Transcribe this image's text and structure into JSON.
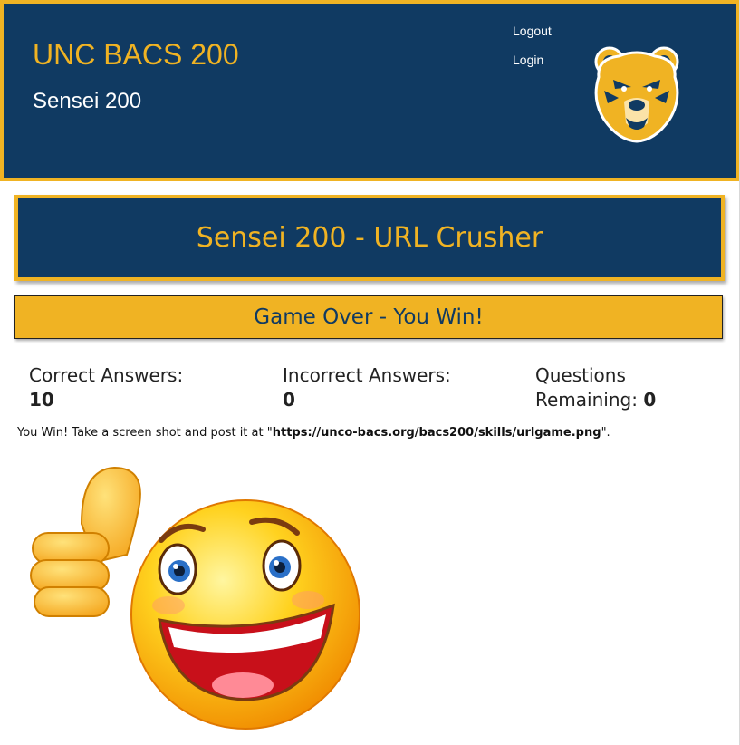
{
  "header": {
    "brand": "UNC BACS 200",
    "subtitle": "Sensei 200",
    "nav": {
      "logout": "Logout",
      "login": "Login"
    },
    "logo_icon": "bear-mascot-icon"
  },
  "game": {
    "title": "Sensei 200 - URL Crusher",
    "status": "Game Over - You Win!"
  },
  "stats": {
    "correct": {
      "label": "Correct Answers:",
      "value": "10"
    },
    "incorrect": {
      "label": "Incorrect Answers:",
      "value": "0"
    },
    "remaining": {
      "label_line1": "Questions",
      "label_line2": "Remaining:",
      "value": "0"
    }
  },
  "message": {
    "prefix": "You Win! Take a screen shot and post it at \"",
    "url": "https://unco-bacs.org/bacs200/skills/urlgame.png",
    "suffix": "\"."
  },
  "image": {
    "icon": "thumbs-up-smiley-icon"
  },
  "colors": {
    "navy": "#103a62",
    "gold": "#f0b323"
  }
}
